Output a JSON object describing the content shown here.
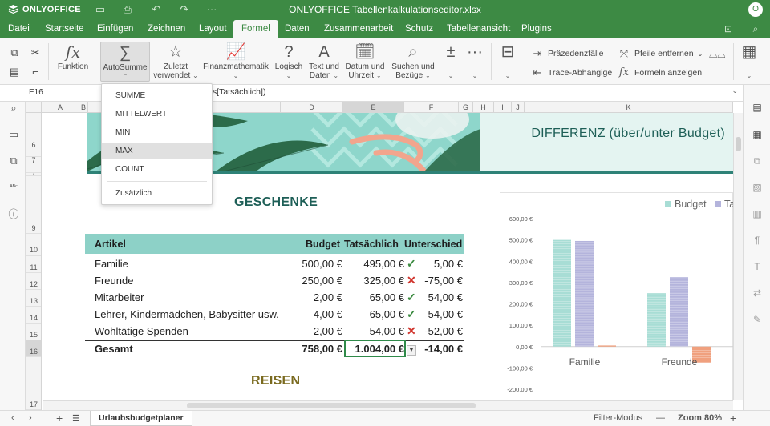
{
  "app": {
    "brand": "ONLYOFFICE",
    "doc_title": "ONLYOFFICE Tabellenkalkulationseditor.xlsx",
    "user_initial": "O"
  },
  "menu_tabs": [
    "Datei",
    "Startseite",
    "Einfügen",
    "Zeichnen",
    "Layout",
    "Formel",
    "Daten",
    "Zusammenarbeit",
    "Schutz",
    "Tabellenansicht",
    "Plugins"
  ],
  "active_tab": "Formel",
  "toolbar": {
    "funktion": "Funktion",
    "autosumme": "AutoSumme",
    "zuletzt_1": "Zuletzt",
    "zuletzt_2": "verwendet",
    "finanz": "Finanzmathematik",
    "logisch": "Logisch",
    "text_1": "Text und",
    "text_2": "Daten",
    "datum_1": "Datum und",
    "datum_2": "Uhrzeit",
    "suchen_1": "Suchen und",
    "suchen_2": "Bezüge",
    "praezedenzfaelle": "Präzedenzfälle",
    "trace_abhaengige": "Trace-Abhängige",
    "pfeile_entfernen": "Pfeile entfernen",
    "formeln_anzeigen": "Formeln anzeigen"
  },
  "formula_bar": {
    "name_box": "E16",
    "formula": "ts[Tatsächlich])"
  },
  "autosum_menu": {
    "items": [
      "SUMME",
      "MITTELWERT",
      "MIN",
      "MAX",
      "COUNT"
    ],
    "highlighted": "MAX",
    "more": "Zusätzlich"
  },
  "columns": [
    "A",
    "B",
    "C",
    "D",
    "E",
    "F",
    "G",
    "H",
    "I",
    "J",
    "K"
  ],
  "rows": [
    "6",
    "7",
    "8",
    "9",
    "10",
    "11",
    "12",
    "13",
    "14",
    "15",
    "16",
    "17"
  ],
  "sheet": {
    "banner_title": "DIFFERENZ (über/unter Budget)",
    "section_gifts": "GESCHENKE",
    "section_travel": "REISEN",
    "headers": {
      "artikel": "Artikel",
      "budget": "Budget",
      "actual": "Tatsächlich",
      "diff": "Unterschied"
    },
    "items": [
      {
        "name": "Familie",
        "budget": "500,00 €",
        "actual": "495,00 €",
        "ok": true,
        "diff": "5,00 €"
      },
      {
        "name": "Freunde",
        "budget": "250,00 €",
        "actual": "325,00 €",
        "ok": false,
        "diff": "-75,00 €"
      },
      {
        "name": "Mitarbeiter",
        "budget": "2,00 €",
        "actual": "65,00 €",
        "ok": true,
        "diff": "54,00 €"
      },
      {
        "name": "Lehrer, Kindermädchen, Babysitter usw.",
        "budget": "4,00 €",
        "actual": "65,00 €",
        "ok": true,
        "diff": "54,00 €"
      },
      {
        "name": "Wohltätige Spenden",
        "budget": "2,00 €",
        "actual": "54,00 €",
        "ok": false,
        "diff": "-52,00 €"
      }
    ],
    "total": {
      "name": "Gesamt",
      "budget": "758,00 €",
      "actual": "1.004,00 €",
      "diff": "-14,00 €"
    }
  },
  "chart_data": {
    "type": "bar",
    "categories": [
      "Familie",
      "Freunde"
    ],
    "series": [
      {
        "name": "Budget",
        "values": [
          500,
          250
        ],
        "color": "#a8ddd5"
      },
      {
        "name": "Ta",
        "values": [
          495,
          325
        ],
        "color": "#b4b4dc"
      },
      {
        "name": "",
        "values": [
          5,
          -75
        ],
        "color": "#f0a07e"
      }
    ],
    "ylim": [
      -200,
      600
    ],
    "yticks": [
      "600,00 €",
      "500,00 €",
      "400,00 €",
      "300,00 €",
      "200,00 €",
      "100,00 €",
      "0,00 €",
      "-100,00 €",
      "-200,00 €"
    ],
    "legend": "top-right",
    "grid": false
  },
  "status": {
    "sheet_name": "Urlaubsbudgetplaner",
    "filter_mode": "Filter-Modus",
    "zoom": "Zoom 80%"
  },
  "colors": {
    "brand_green": "#3d8a44",
    "teal_header": "#8dd1c7",
    "ok": "#3a8a3f",
    "bad": "#d0342c"
  }
}
